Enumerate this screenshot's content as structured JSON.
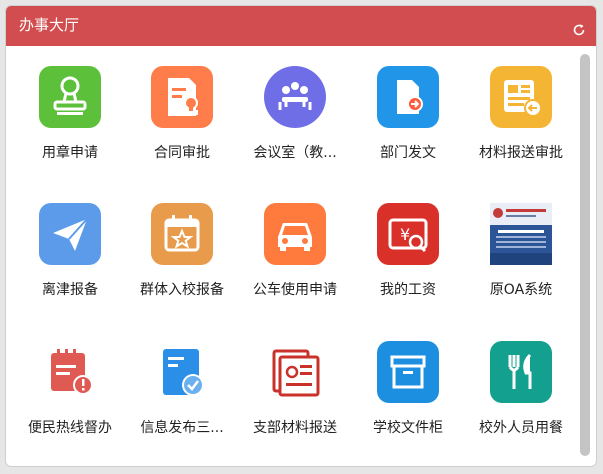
{
  "panel": {
    "title": "办事大厅",
    "refresh_icon": "refresh-icon"
  },
  "colors": {
    "header": "#d24d4f",
    "green": "#5cc03a",
    "orange": "#ff7d4a",
    "purple": "#6f6ee6",
    "blue": "#2196e8",
    "yellow": "#f4b534",
    "sky": "#5c9bea",
    "tan": "#e89b4a",
    "red": "#d9312a",
    "teal": "#14a08f"
  },
  "tiles": [
    {
      "label": "用章申请",
      "icon": "seal-icon"
    },
    {
      "label": "合同审批",
      "icon": "contract-stamp-icon"
    },
    {
      "label": "会议室（教...",
      "icon": "meeting-room-icon"
    },
    {
      "label": "部门发文",
      "icon": "document-send-icon"
    },
    {
      "label": "材料报送审批",
      "icon": "newspaper-submit-icon"
    },
    {
      "label": "离津报备",
      "icon": "paper-plane-icon"
    },
    {
      "label": "群体入校报备",
      "icon": "calendar-star-icon"
    },
    {
      "label": "公车使用申请",
      "icon": "car-icon"
    },
    {
      "label": "我的工资",
      "icon": "salary-search-icon"
    },
    {
      "label": "原OA系统",
      "icon": "oa-system-thumbnail"
    },
    {
      "label": "便民热线督办",
      "icon": "calendar-alert-icon"
    },
    {
      "label": "信息发布三...",
      "icon": "document-check-icon"
    },
    {
      "label": "支部材料报送",
      "icon": "party-document-icon"
    },
    {
      "label": "学校文件柜",
      "icon": "file-cabinet-icon"
    },
    {
      "label": "校外人员用餐",
      "icon": "dining-icon"
    }
  ]
}
